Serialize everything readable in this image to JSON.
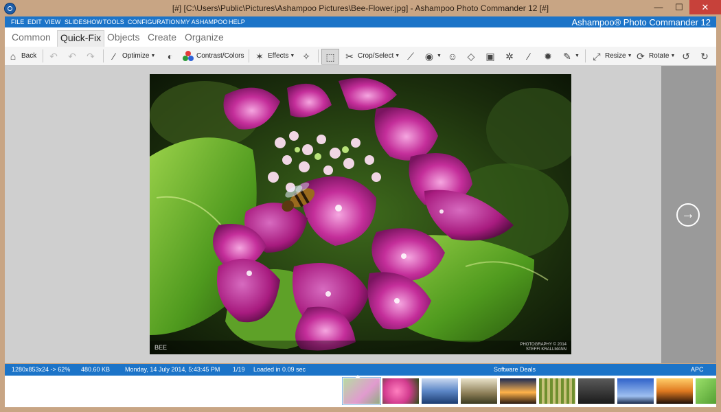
{
  "window": {
    "title": "[#] [C:\\Users\\Public\\Pictures\\Ashampoo Pictures\\Bee-Flower.jpg] - Ashampoo Photo Commander 12 [#]",
    "minimize": "—",
    "maximize": "☐",
    "close": "✕"
  },
  "menu": {
    "items": [
      "FILE",
      "EDIT",
      "VIEW",
      "SLIDESHOW",
      "TOOLS",
      "CONFIGURATION",
      "MY ASHAMPOO",
      "HELP"
    ],
    "brand": "Ashampoo® Photo Commander 12"
  },
  "tabs": {
    "items": [
      "Common",
      "Quick-Fix",
      "Objects",
      "Create",
      "Organize"
    ],
    "active": "Quick-Fix"
  },
  "toolbar": {
    "back": "Back",
    "optimize": "Optimize",
    "contrast": "Contrast/Colors",
    "effects": "Effects",
    "crop": "Crop/Select",
    "resize": "Resize",
    "rotate": "Rotate"
  },
  "photo": {
    "caption": "BEE",
    "credit_line1": "PHOTOGRAPHY © 2014",
    "credit_line2": "STEFFI KRALLMANN"
  },
  "status": {
    "dimensions": "1280x853x24 -> 62%",
    "filesize": "480.60 KB",
    "date": "Monday, 14 July 2014, 5:43:45 PM",
    "position": "1/19",
    "loaded": "Loaded in 0.09 sec",
    "deals": "Software Deals",
    "apc": "APC"
  },
  "colors": {
    "accent": "#1c74c8",
    "frame": "#c8a584",
    "close": "#c7413a"
  },
  "filmstrip": {
    "thumbnails": [
      "hydrangea",
      "pink-flowers",
      "blue-bench",
      "pavilion",
      "sunset-window",
      "bamboo",
      "cat",
      "blue-sky",
      "sunset-silhouette",
      "leaves"
    ]
  }
}
